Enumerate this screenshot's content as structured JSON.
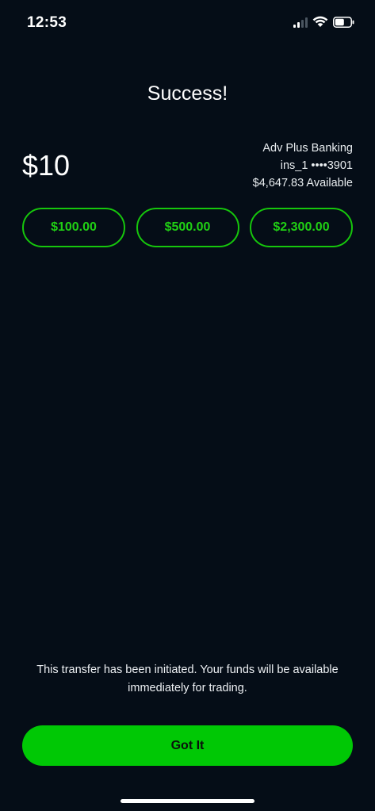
{
  "status_bar": {
    "time": "12:53",
    "icons": [
      "signal-icon",
      "wifi-icon",
      "battery-icon"
    ]
  },
  "title": "Success!",
  "transfer": {
    "amount": "$10"
  },
  "account": {
    "name": "Adv Plus Banking",
    "number": "ins_1 ••••3901",
    "available": "$4,647.83 Available"
  },
  "presets": [
    {
      "label": "$100.00"
    },
    {
      "label": "$500.00"
    },
    {
      "label": "$2,300.00"
    }
  ],
  "message": "This transfer has been initiated. Your funds will be available immediately for trading.",
  "button": {
    "label": "Got It"
  },
  "colors": {
    "background": "#050d17",
    "accent": "#00c805",
    "chip_border": "#16c60c"
  }
}
